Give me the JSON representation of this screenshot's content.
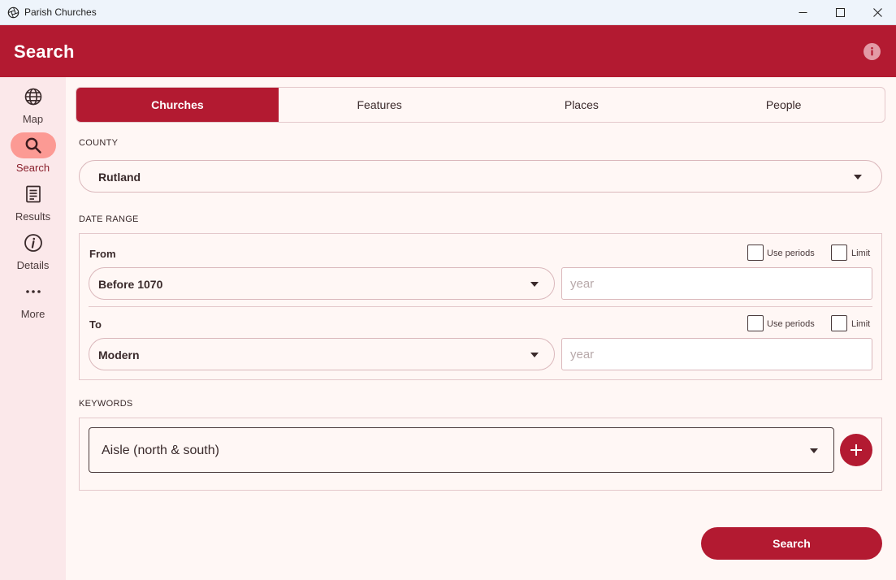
{
  "window": {
    "title": "Parish Churches",
    "icon": "app-aperture-icon"
  },
  "appbar": {
    "title": "Search",
    "info_icon": "info-icon"
  },
  "rail": {
    "items": [
      {
        "label": "Map",
        "icon": "globe-icon",
        "active": false
      },
      {
        "label": "Search",
        "icon": "search-icon",
        "active": true
      },
      {
        "label": "Results",
        "icon": "document-icon",
        "active": false
      },
      {
        "label": "Details",
        "icon": "info-circle-icon",
        "active": false
      },
      {
        "label": "More",
        "icon": "ellipsis-icon",
        "active": false
      }
    ]
  },
  "tabs": [
    {
      "label": "Churches",
      "active": true
    },
    {
      "label": "Features",
      "active": false
    },
    {
      "label": "Places",
      "active": false
    },
    {
      "label": "People",
      "active": false
    }
  ],
  "county": {
    "label": "COUNTY",
    "value": "Rutland"
  },
  "date_range": {
    "label": "DATE RANGE",
    "from": {
      "label": "From",
      "value": "Before 1070",
      "year_placeholder": "year",
      "use_periods_label": "Use periods",
      "use_periods_checked": false,
      "limit_label": "Limit",
      "limit_checked": false
    },
    "to": {
      "label": "To",
      "value": "Modern",
      "year_placeholder": "year",
      "use_periods_label": "Use periods",
      "use_periods_checked": false,
      "limit_label": "Limit",
      "limit_checked": false
    }
  },
  "keywords": {
    "label": "KEYWORDS",
    "value": "Aisle (north & south)",
    "add_icon": "plus-icon"
  },
  "search_button": {
    "label": "Search"
  },
  "colors": {
    "primary": "#b31a31",
    "rail_bg": "#fbe8ea",
    "rail_active": "#fc9a94",
    "surface": "#fff7f5",
    "outline": "#e4c8cb"
  }
}
